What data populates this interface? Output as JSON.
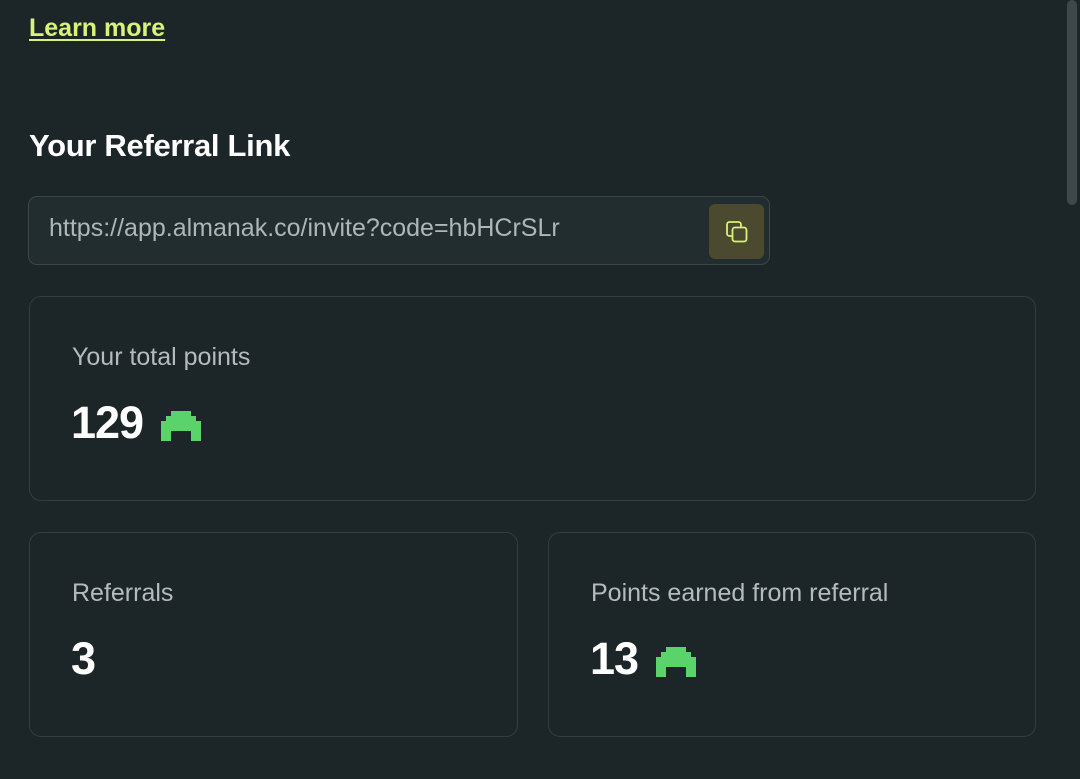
{
  "learn_more": {
    "label": "Learn more"
  },
  "referral": {
    "title": "Your Referral Link",
    "link": "https://app.almanak.co/invite?code=hbHCrSLr",
    "copy_icon": "copy-icon"
  },
  "stats": {
    "total": {
      "label": "Your total points",
      "value": "129",
      "icon": "points-icon"
    },
    "referrals": {
      "label": "Referrals",
      "value": "3"
    },
    "earned": {
      "label": "Points earned from referral",
      "value": "13",
      "icon": "points-icon"
    }
  },
  "colors": {
    "background": "#1c2628",
    "accent": "#d8f27a",
    "points_icon": "#5ad46a",
    "copy_button": "#4b4a2e"
  }
}
